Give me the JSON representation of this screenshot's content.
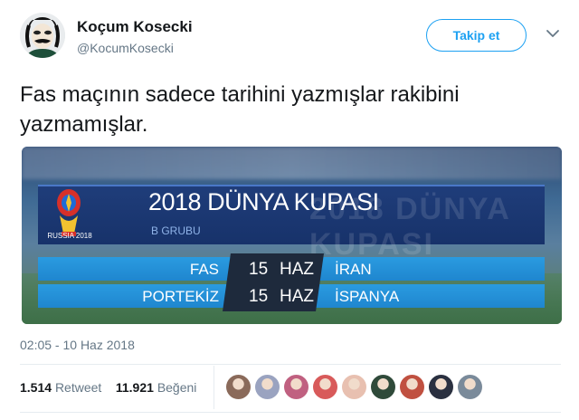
{
  "tweet": {
    "author_name": "Koçum Kosecki",
    "author_handle": "@KocumKosecki",
    "follow_label": "Takip et",
    "text": "Fas maçının sadece tarihini yazmışlar rakibini yazmamışlar.",
    "timestamp": "02:05 - 10 Haz 2018",
    "retweet_count": "1.514",
    "retweet_label": "Retweet",
    "like_count": "11.921",
    "like_label": "Beğeni"
  },
  "media": {
    "logo_text": "RUSSIA 2018",
    "title": "2018 DÜNYA KUPASI",
    "group": "B GRUBU",
    "matches": [
      {
        "team_left": "FAS",
        "day": "15",
        "month": "HAZ",
        "team_right": "İRAN"
      },
      {
        "team_left": "PORTEKİZ",
        "day": "15",
        "month": "HAZ",
        "team_right": "İSPANYA"
      }
    ]
  },
  "likers": {
    "colors": [
      "#8a6a5a",
      "#9aa3c0",
      "#c06080",
      "#d85a5a",
      "#e8c0b0",
      "#2f4a3a",
      "#c05040",
      "#2a3040",
      "#7a8a9a"
    ]
  },
  "colors": {
    "accent": "#1da1f2",
    "text": "#14171a",
    "muted": "#657786"
  },
  "icons": {
    "caret": "chevron-down-icon"
  }
}
